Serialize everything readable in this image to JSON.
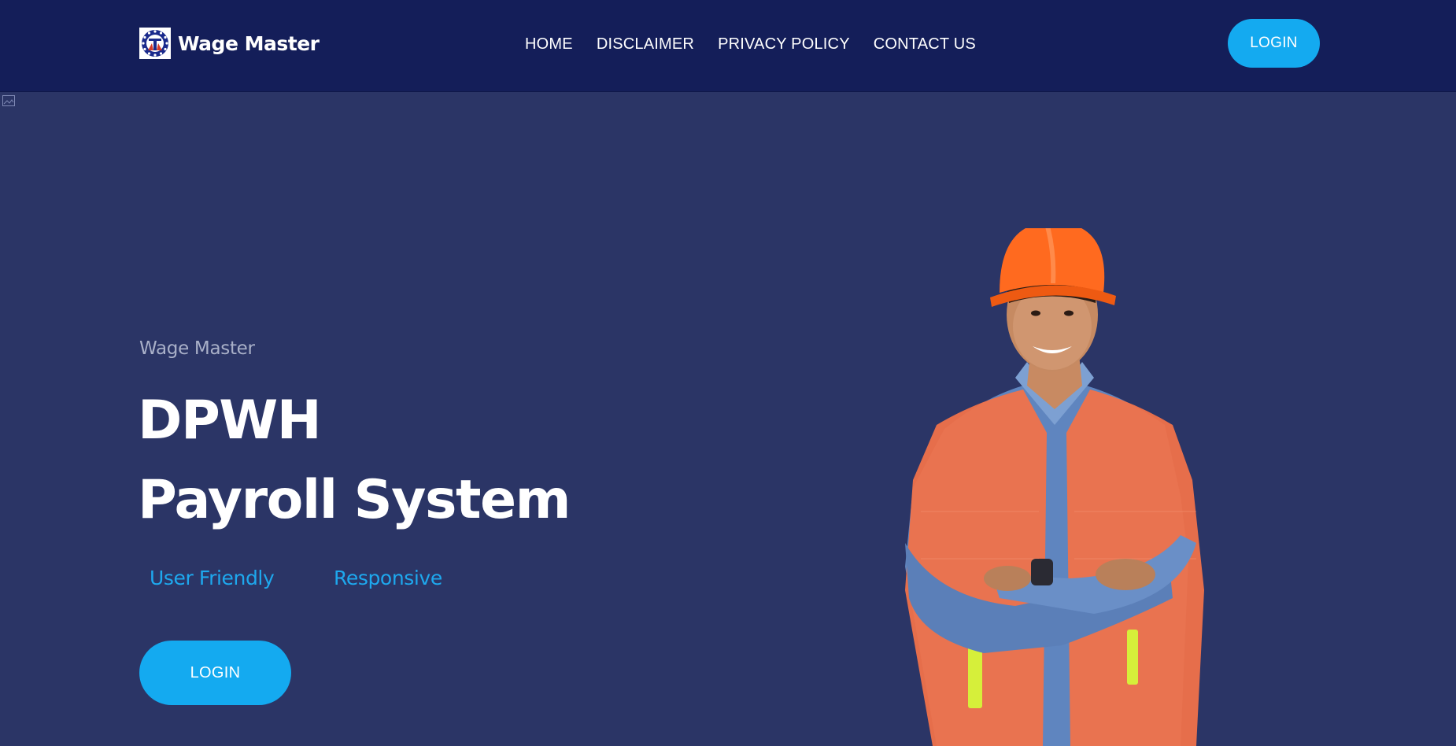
{
  "header": {
    "brand": {
      "name": "Wage Master",
      "logo_icon": "dpwh-seal-icon"
    },
    "nav": [
      {
        "label": "HOME"
      },
      {
        "label": "DISCLAIMER"
      },
      {
        "label": "PRIVACY POLICY"
      },
      {
        "label": "CONTACT US"
      }
    ],
    "login_label": "LOGIN"
  },
  "hero": {
    "eyebrow": "Wage Master",
    "title_line_1": "DPWH",
    "title_line_2": "Payroll System",
    "features": [
      "User Friendly",
      "Responsive"
    ],
    "login_label": "LOGIN",
    "image_icon": "construction-worker-image"
  },
  "colors": {
    "header_bg": "#141e59",
    "page_bg": "#2b3566",
    "accent": "#14aaf0",
    "feature_text": "#1ea8ee",
    "eyebrow_text": "#a9b0c8"
  }
}
